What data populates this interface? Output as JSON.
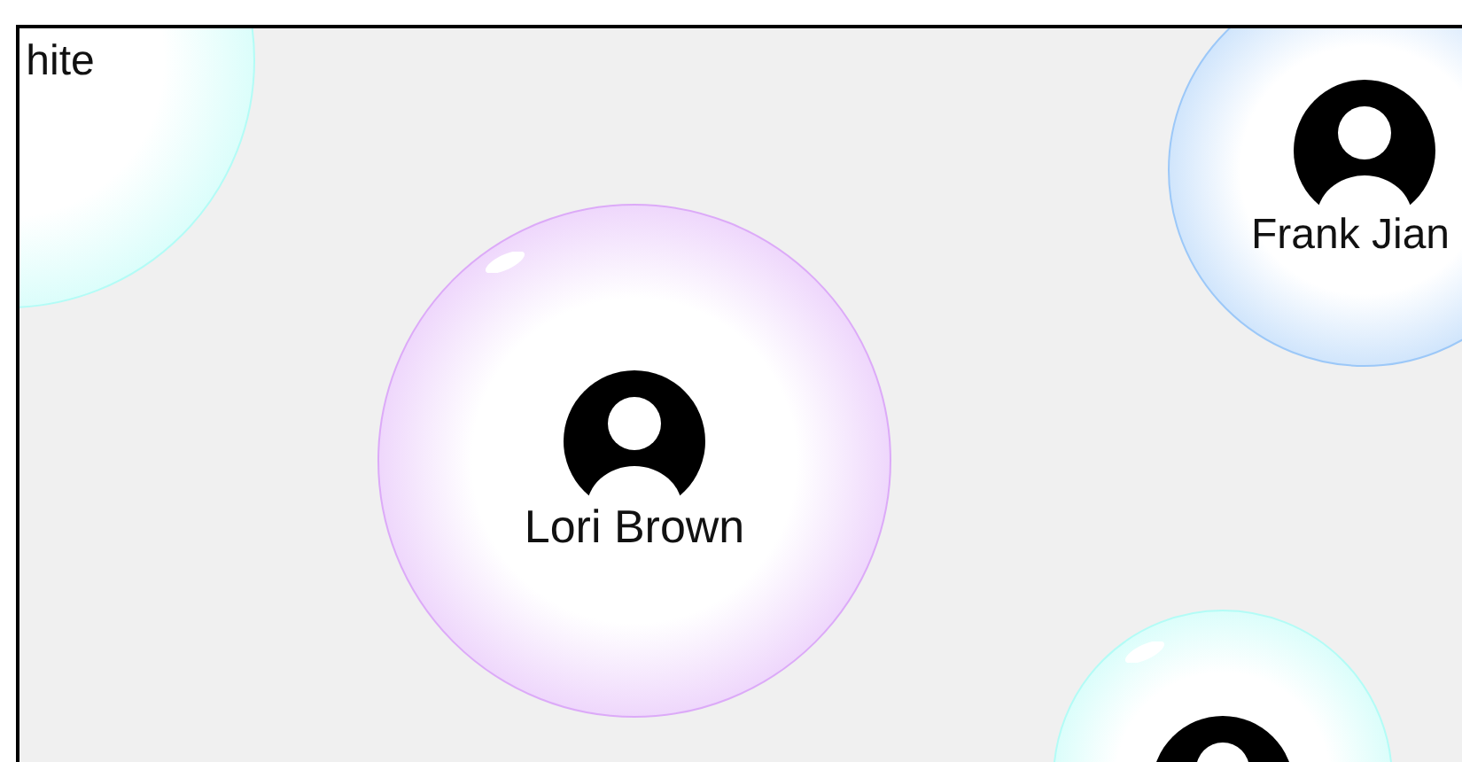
{
  "bubbles": [
    {
      "name": "hite",
      "avatar": false,
      "color": "#b3fcf6"
    },
    {
      "name": "Lori Brown",
      "avatar": true,
      "color": "#dcaaf8"
    },
    {
      "name": "Frank Jian",
      "avatar": true,
      "color": "#9cc8f8"
    },
    {
      "avatar": true,
      "color": "#b3fcf6"
    }
  ]
}
